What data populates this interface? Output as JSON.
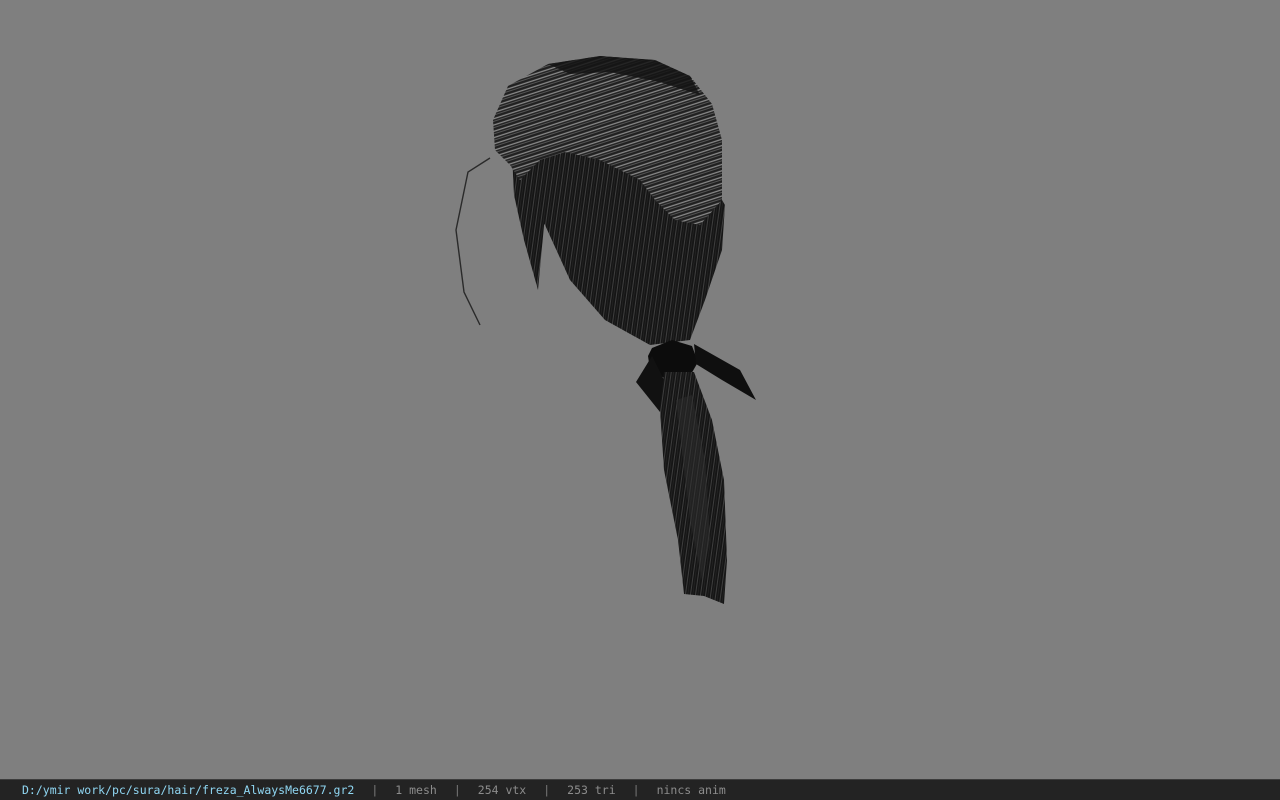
{
  "viewport": {
    "background": "#7f7f7f",
    "model": "hair-mesh"
  },
  "status": {
    "path": "D:/ymir work/pc/sura/hair/freza_AlwaysMe6677.gr2",
    "mesh": "1 mesh",
    "vtx": "254 vtx",
    "tri": "253 tri",
    "anim": "nincs anim",
    "separator": "|",
    "path_color": "#8fd6f2"
  }
}
